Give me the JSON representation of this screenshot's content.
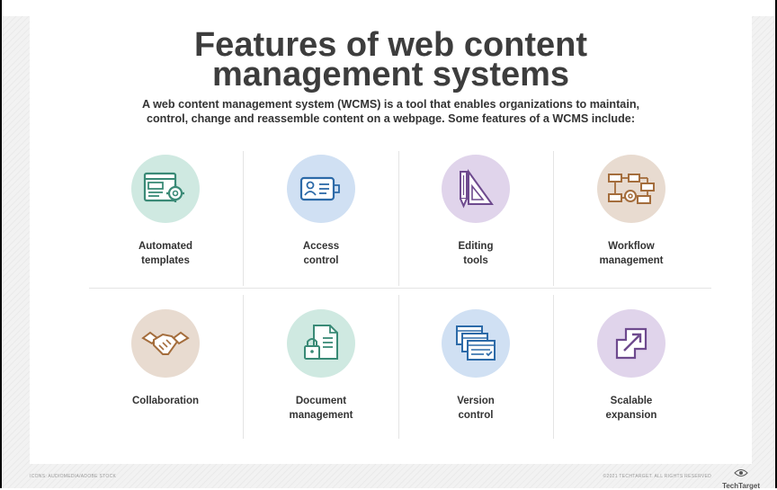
{
  "title_line1": "Features of web content",
  "title_line2": "management systems",
  "subtitle_line1": "A web content management system (WCMS) is a tool that enables organizations to maintain,",
  "subtitle_line2": "control, change and reassemble content on a webpage. Some features of a WCMS include:",
  "colors": {
    "teal": "#cfe9e1",
    "blue": "#d0e0f3",
    "purple": "#e0d4eb",
    "tan": "#e8dbd0",
    "icon_teal": "#3a8a76",
    "icon_blue": "#2c6aa8",
    "icon_purple": "#6e4a8e",
    "icon_tan": "#a46d3c"
  },
  "features": [
    {
      "icon": "template-gear-icon",
      "line1": "Automated",
      "line2": "templates"
    },
    {
      "icon": "id-card-icon",
      "line1": "Access",
      "line2": "control"
    },
    {
      "icon": "pencil-ruler-icon",
      "line1": "Editing",
      "line2": "tools"
    },
    {
      "icon": "flowchart-icon",
      "line1": "Workflow",
      "line2": "management"
    },
    {
      "icon": "handshake-icon",
      "line1": "Collaboration",
      "line2": ""
    },
    {
      "icon": "locked-document-icon",
      "line1": "Document",
      "line2": "management"
    },
    {
      "icon": "stacked-windows-icon",
      "line1": "Version",
      "line2": "control"
    },
    {
      "icon": "expand-arrow-icon",
      "line1": "Scalable",
      "line2": "expansion"
    }
  ],
  "footer": {
    "credit": "ICONS: AUDIOMEDIA/ADOBE STOCK",
    "copyright": "©2021 TECHTARGET. ALL RIGHTS RESERVED",
    "brand": "TechTarget"
  }
}
